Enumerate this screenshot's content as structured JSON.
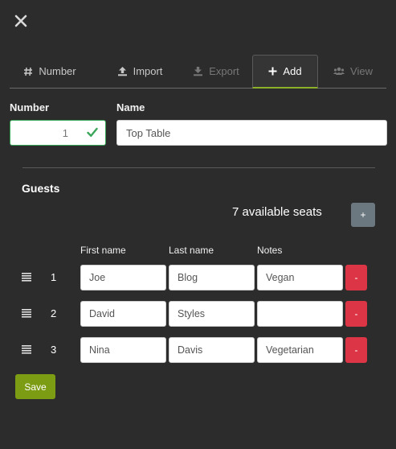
{
  "close": {
    "icon": "close-icon"
  },
  "tabs": [
    {
      "label": "Number",
      "icon": "hash-icon",
      "state": "normal"
    },
    {
      "label": "Import",
      "icon": "upload-icon",
      "state": "normal"
    },
    {
      "label": "Export",
      "icon": "download-icon",
      "state": "disabled"
    },
    {
      "label": "Add",
      "icon": "plus-icon",
      "state": "active"
    },
    {
      "label": "View",
      "icon": "users-icon",
      "state": "disabled"
    }
  ],
  "form": {
    "number_label": "Number",
    "number_value": "1",
    "name_label": "Name",
    "name_value": "Top Table"
  },
  "guests": {
    "title": "Guests",
    "available_seats": "7 available seats",
    "add_label": "+",
    "columns": {
      "first": "First name",
      "last": "Last name",
      "notes": "Notes"
    },
    "rows": [
      {
        "num": "1",
        "first": "Joe",
        "last": "Blog",
        "notes": "Vegan",
        "remove": "-"
      },
      {
        "num": "2",
        "first": "David",
        "last": "Styles",
        "notes": "",
        "remove": "-"
      },
      {
        "num": "3",
        "first": "Nina",
        "last": "Davis",
        "notes": "Vegetarian",
        "remove": "-"
      }
    ]
  },
  "save_label": "Save",
  "colors": {
    "background": "#2c2c2c",
    "active_tab_underline": "#8db02a",
    "valid_border": "#3aa65a",
    "remove": "#dc3545",
    "save": "#7c9c14",
    "add_guest": "#6c7880"
  }
}
